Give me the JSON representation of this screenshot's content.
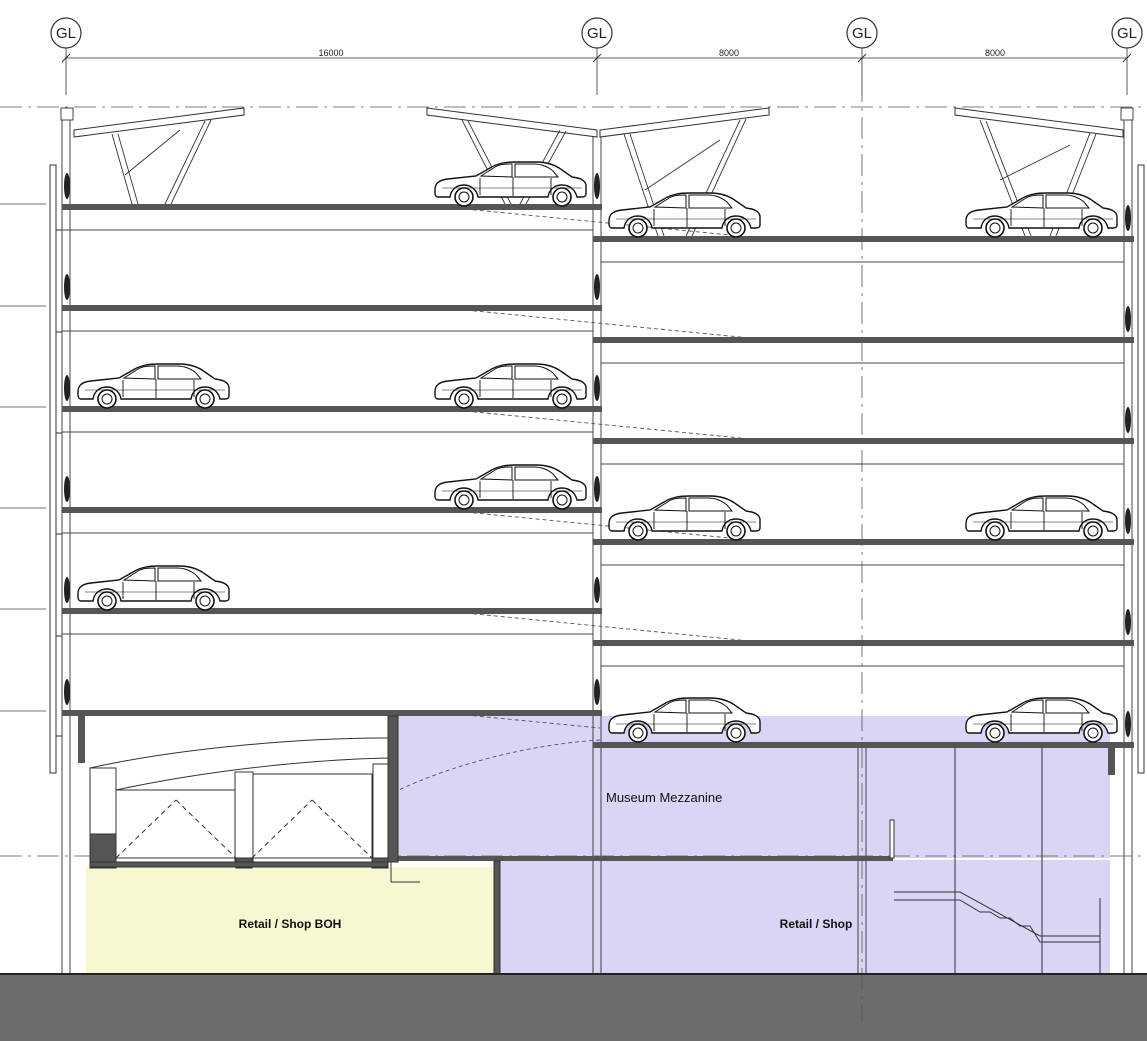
{
  "drawing": {
    "gridlines": [
      {
        "label": "GL"
      },
      {
        "label": "GL"
      },
      {
        "label": "GL"
      },
      {
        "label": "GL"
      }
    ],
    "dimensions": [
      "16000",
      "8000",
      "8000"
    ],
    "rooms": {
      "museum_mezzanine": "Museum Mezzanine",
      "retail_boh": "Retail / Shop BOH",
      "retail_shop": "Retail / Shop"
    },
    "colors": {
      "museum_fill": "#d9d5f5",
      "boh_fill": "#f7f7d2",
      "ground_fill": "#6d6d6d",
      "slab": "#555555",
      "line": "#333333"
    }
  }
}
